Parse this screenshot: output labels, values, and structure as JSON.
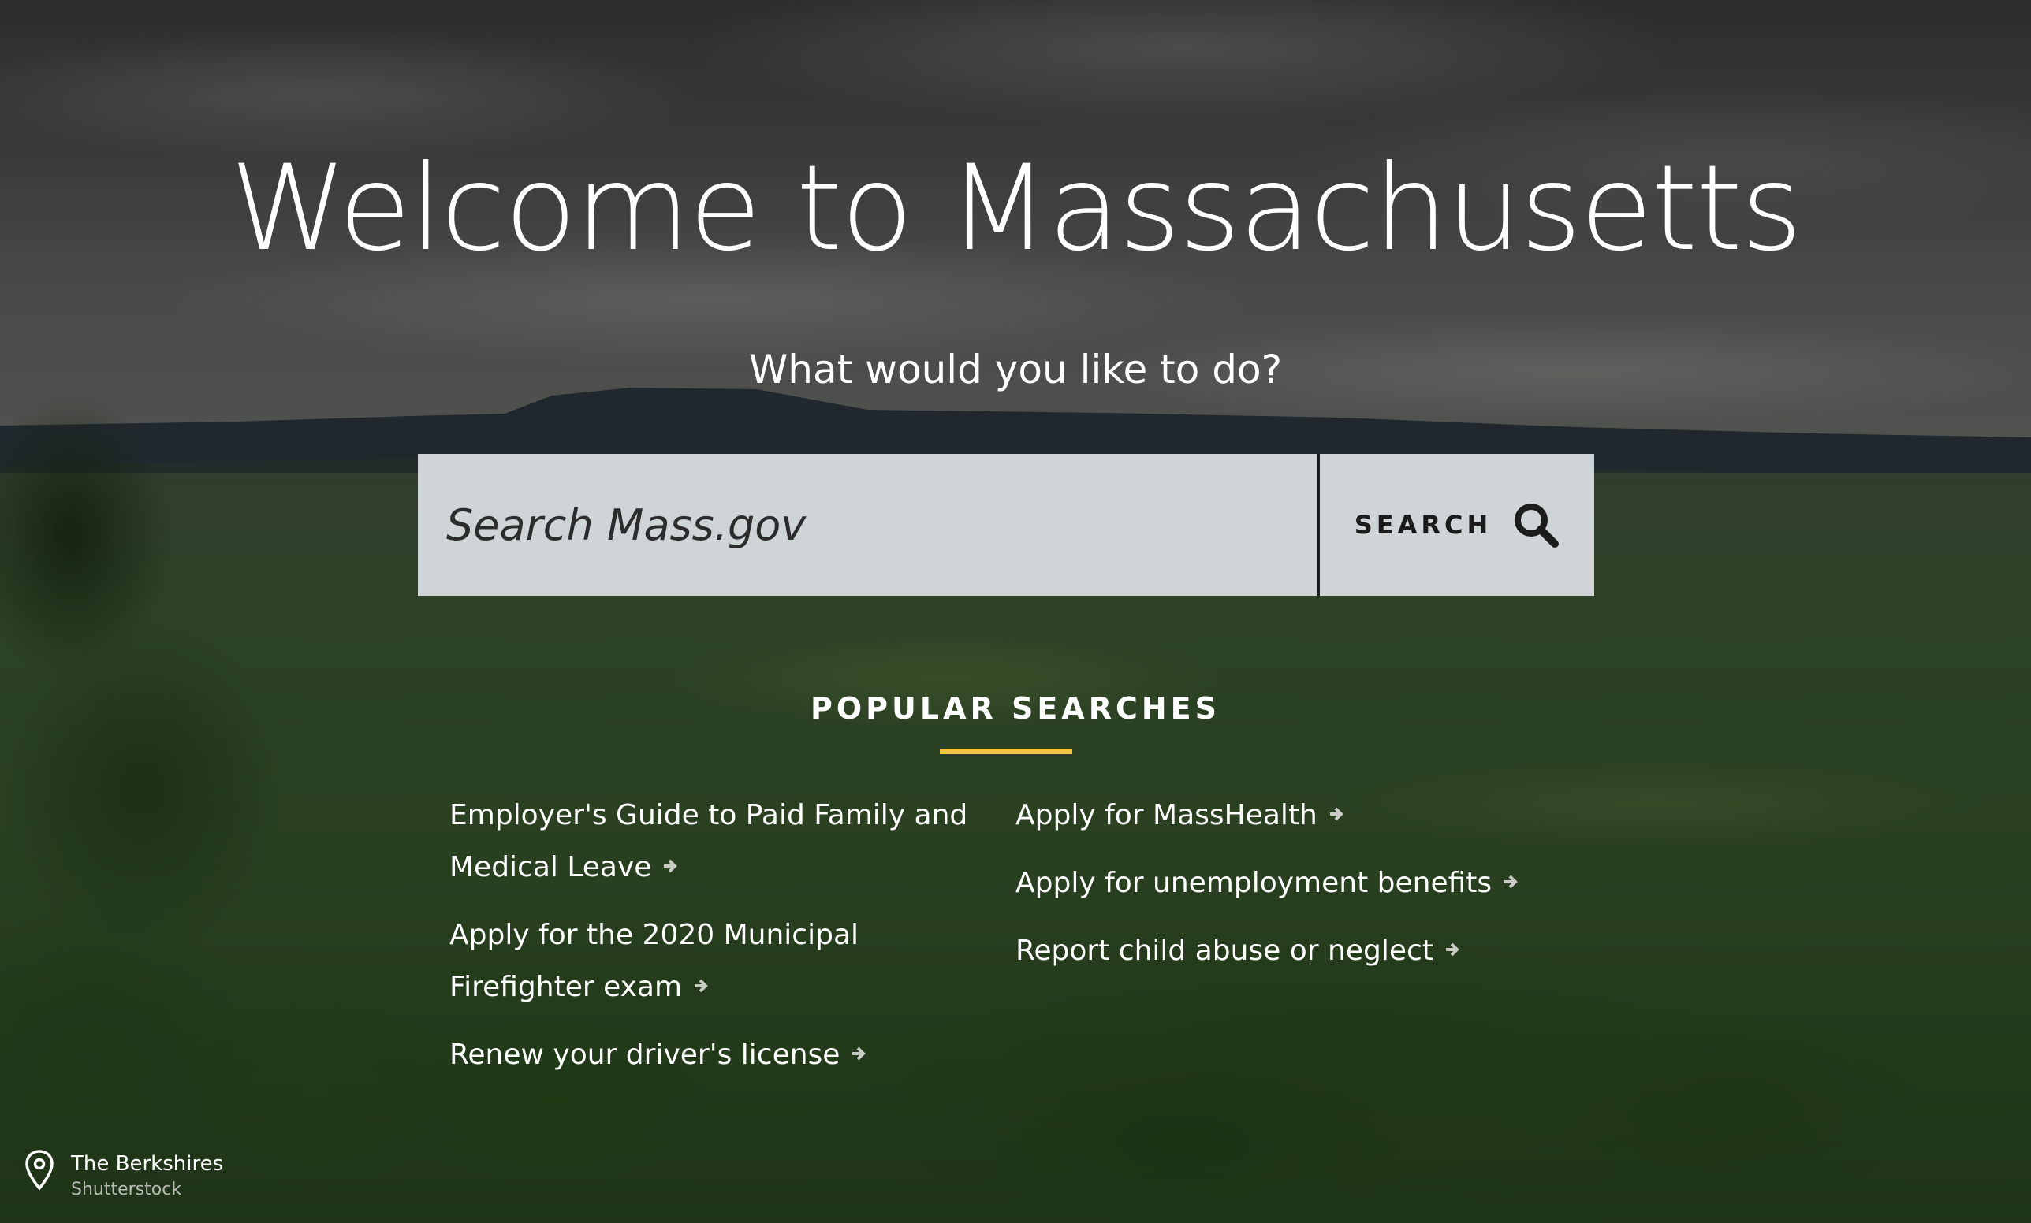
{
  "hero": {
    "title": "Welcome to Massachusetts",
    "subtitle": "What would you like to do?"
  },
  "search": {
    "placeholder": "Search Mass.gov",
    "button_label": "SEARCH",
    "icon": "search-icon"
  },
  "popular_searches": {
    "heading": "POPULAR SEARCHES",
    "underline_color": "#f0c43c",
    "left_column": [
      {
        "label": "Employer's Guide to Paid Family and Medical Leave"
      },
      {
        "label": "Apply for the 2020 Municipal Firefighter exam"
      },
      {
        "label": "Renew your driver's license"
      }
    ],
    "right_column": [
      {
        "label": "Apply for MassHealth"
      },
      {
        "label": "Apply for unemployment benefits"
      },
      {
        "label": "Report child abuse or neglect"
      }
    ],
    "link_icon": "arrow-right-icon"
  },
  "photo_credit": {
    "icon": "map-pin-icon",
    "location": "The Berkshires",
    "source": "Shutterstock"
  }
}
